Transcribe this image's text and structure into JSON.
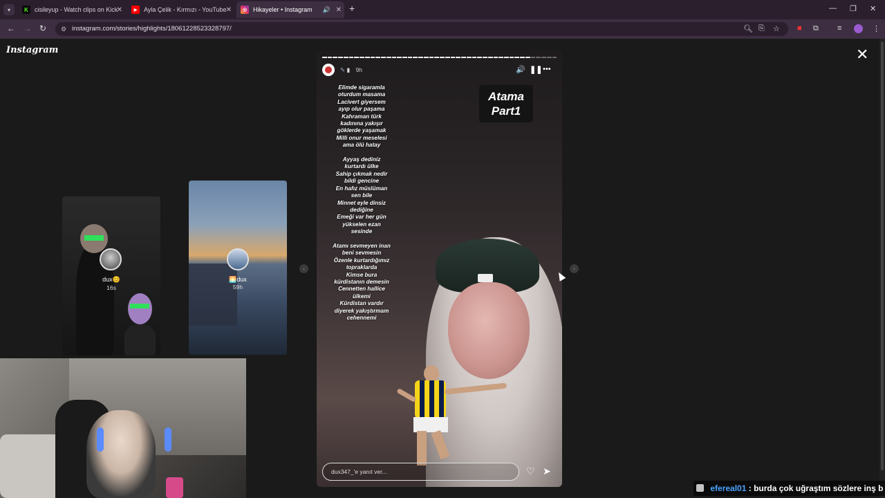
{
  "browser": {
    "tabs": [
      {
        "title": "cisileyup - Watch clips on Kick",
        "icon": "kick-icon",
        "color": "#53fc18"
      },
      {
        "title": "Ayla Çelik - Kırmızı - YouTube",
        "icon": "youtube-icon",
        "color": "#ff0000"
      },
      {
        "title": "Hikayeler • Instagram",
        "icon": "instagram-icon",
        "color": "#e1306c"
      }
    ],
    "url": "instagram.com/stories/highlights/18061228523328797/"
  },
  "instagram": {
    "logo": "Instagram",
    "previews": [
      {
        "name": "dux😊",
        "time": "16s"
      },
      {
        "name": "🌅dux",
        "time": "59h"
      }
    ],
    "story": {
      "time": "9h",
      "lyrics": "Elimde sigaramla\noturdum masama\nLacivert giyersem\nayıp olur paşama\nKahraman türk\nkadınına yakışır\ngöklerde yaşamak\nMilli onur meselesi\nama ölü hatay\n\nAyyaş dediniz\nkurtardı ülke\nSahip çıkmak nedir\nbildi gencine\nEn hafız müslüman\nsen bile\nMinnet eyle dinsiz\ndediğine\nEmeği var her gün\nyükselen ezan\nsesinde\n\nAtamı sevmeyen inan\nbeni sevmesin\nÖzenle kurtardığımız\ntopraklarda\nKimse bura\nkürdistanın demesin\nCennetten hallice\nülkemi\nKürdistan vardır\ndiyerek yakıştırmam\ncehennemi",
      "title_overlay": "Atama\nPart1",
      "reply_placeholder": "dux347_'e yanıt ver..."
    }
  },
  "chat": {
    "user": "efereal01",
    "message": ": burda çok uğraştım sözlere inş b"
  }
}
